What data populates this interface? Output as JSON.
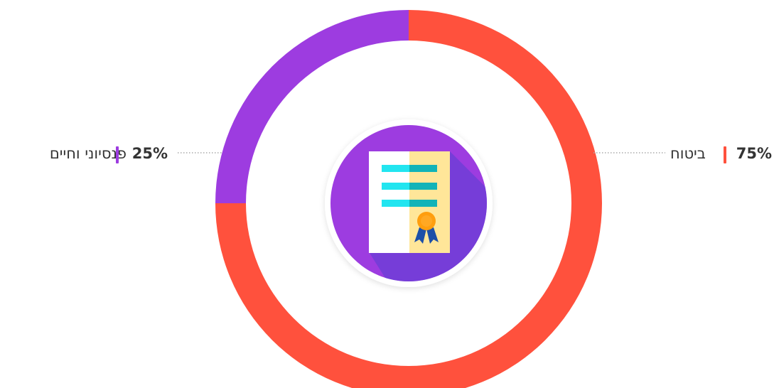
{
  "chart_data": {
    "type": "pie",
    "donut": true,
    "slices": [
      {
        "label": "ביטוח",
        "value": 75,
        "display": "75%",
        "color": "#FF513D"
      },
      {
        "label": "פנסיוני וחיים",
        "value": 25,
        "display": "25%",
        "color": "#9D3CE0"
      }
    ],
    "center_icon": "certificate-icon",
    "leader_line_color": "#aaaaaa"
  }
}
